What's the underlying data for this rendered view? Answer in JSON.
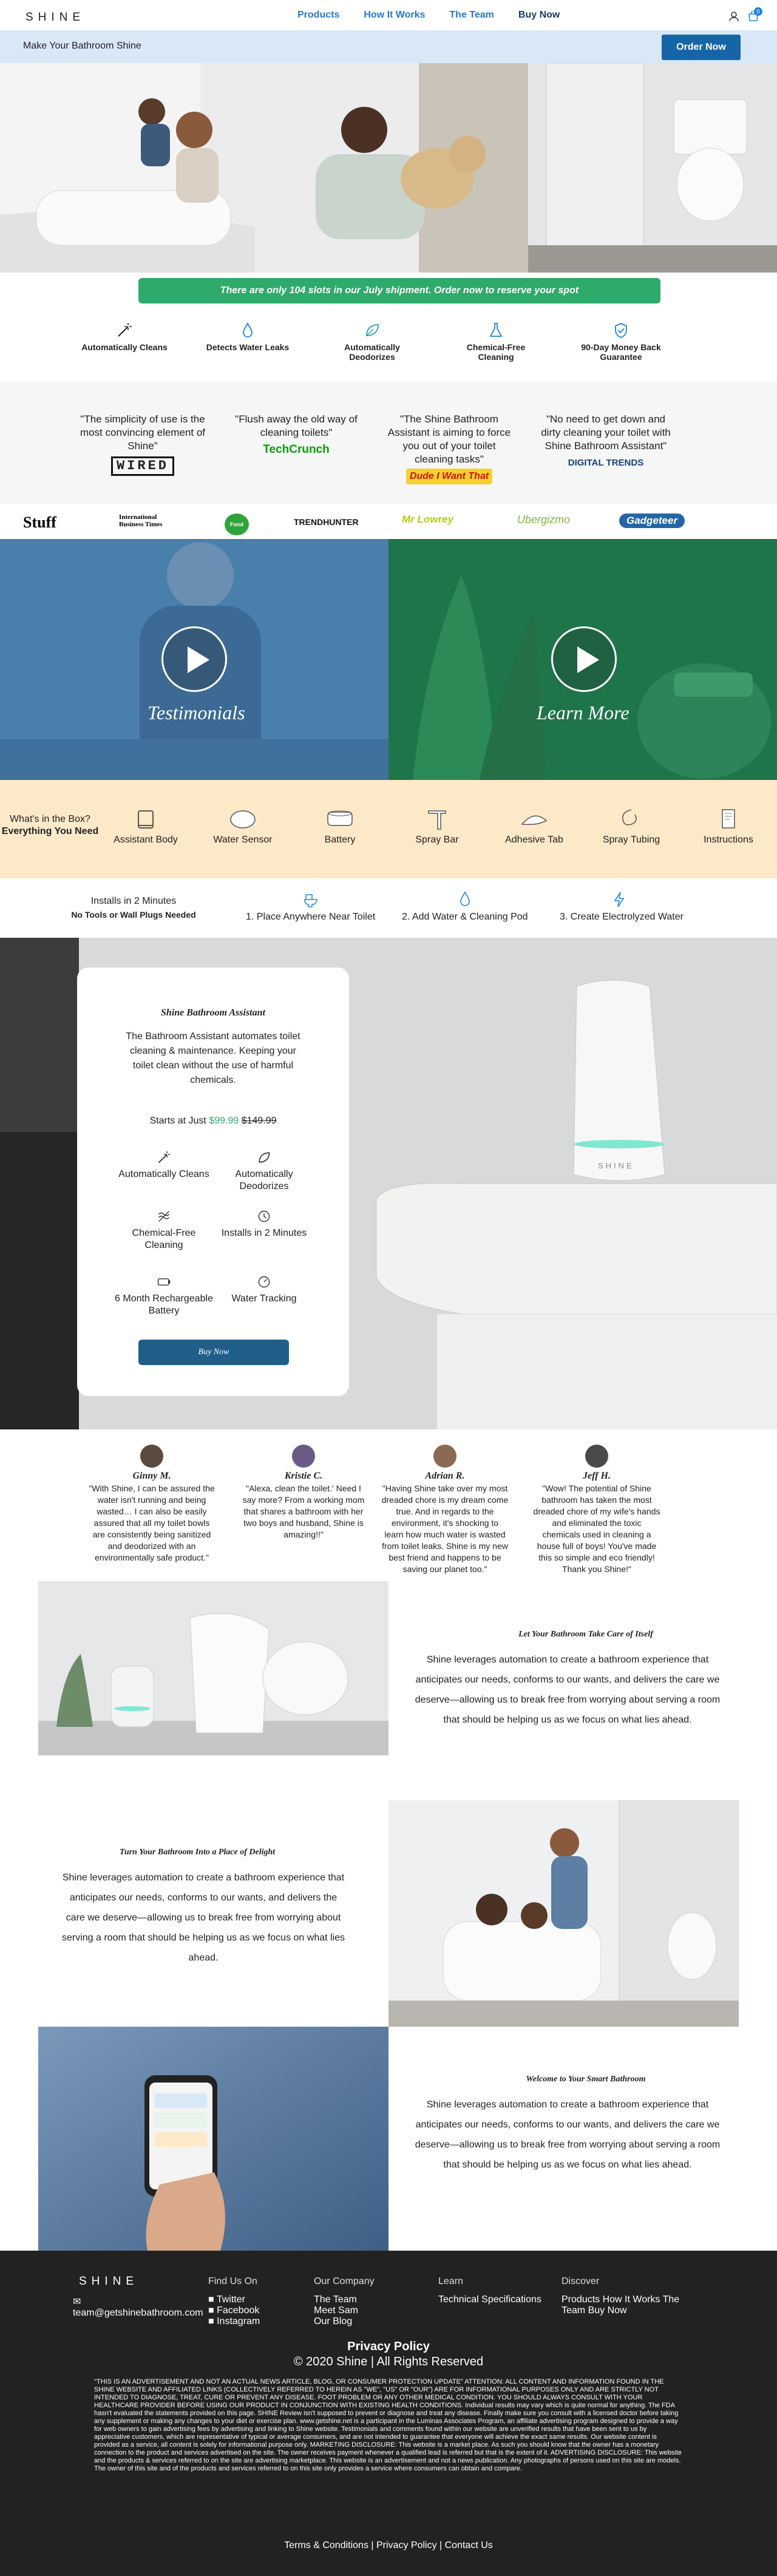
{
  "header": {
    "logo": "SHINE",
    "nav": [
      "Products",
      "How It Works",
      "The Team",
      "Buy Now"
    ],
    "cart_count": "0"
  },
  "subbar": {
    "title": "Make Your Bathroom Shine",
    "order_button": "Order Now"
  },
  "promo": "There are only 104 slots in our July shipment. Order now to reserve your spot",
  "features": [
    {
      "icon": "wand-icon",
      "label": "Automatically Cleans"
    },
    {
      "icon": "droplet-icon",
      "label": "Detects Water Leaks"
    },
    {
      "icon": "leaf-icon",
      "label": "Automatically Deodorizes"
    },
    {
      "icon": "flask-icon",
      "label": "Chemical-Free Cleaning"
    },
    {
      "icon": "shield-check-icon",
      "label": "90-Day Money Back Guarantee"
    }
  ],
  "quotes": [
    {
      "text": "\"The simplicity of use is the most convincing element of Shine\"",
      "source": "WIRED"
    },
    {
      "text": "\"Flush away the old way of cleaning toilets\"",
      "source": "TechCrunch"
    },
    {
      "text": "\"The Shine Bathroom Assistant is aiming to force you out of your toilet cleaning tasks\"",
      "source": "Dude I Want That"
    },
    {
      "text": "\"No need to get down and dirty cleaning your toilet with Shine Bathroom Assistant\"",
      "source": "DIGITAL TRENDS"
    }
  ],
  "press_logos": [
    "Stuff",
    "International Business Times",
    "Food Network",
    "TRENDHUNTER",
    "Mr Lowrey",
    "Ubergizmo",
    "Gadgeteer"
  ],
  "videos": {
    "left_label": "Testimonials",
    "right_label": "Learn More"
  },
  "box": {
    "heading_line1": "What's in the Box?",
    "heading_line2": "Everything You Need",
    "items": [
      "Assistant Body",
      "Water Sensor",
      "Battery",
      "Spray Bar",
      "Adhesive Tab",
      "Spray Tubing",
      "Instructions"
    ]
  },
  "install": {
    "heading_line1": "Installs in 2 Minutes",
    "heading_line2": "No Tools or Wall Plugs Needed",
    "steps": [
      "1. Place Anywhere Near Toilet",
      "2. Add Water & Cleaning Pod",
      "3. Create Electrolyzed Water"
    ]
  },
  "product": {
    "title": "Shine Bathroom Assistant",
    "description": "The Bathroom Assistant automates toilet cleaning & maintenance. Keeping your toilet clean without the use of harmful chemicals.",
    "price_prefix": "Starts at Just",
    "price_sale": "$99.99",
    "price_orig": "$149.99",
    "features": [
      {
        "icon": "wand-icon",
        "label": "Automatically Cleans"
      },
      {
        "icon": "leaf-icon",
        "label": "Automatically Deodorizes"
      },
      {
        "icon": "chemical-free-icon",
        "label": "Chemical-Free Cleaning"
      },
      {
        "icon": "clock-icon",
        "label": "Installs in 2 Minutes"
      },
      {
        "icon": "battery-icon",
        "label": "6 Month Rechargeable Battery"
      },
      {
        "icon": "gauge-icon",
        "label": "Water Tracking"
      }
    ],
    "button": "Buy Now",
    "device_label": "SHINE"
  },
  "testimonials": [
    {
      "name": "Ginny M.",
      "text": "\"With Shine, I can be assured the water isn't running and being wasted… I can also be easily assured that all my toilet bowls are consistently being sanitized and deodorized with an environmentally safe product.\""
    },
    {
      "name": "Kristie C.",
      "text": "\"Alexa, clean the toilet.' Need I say more? From a working mom that shares a bathroom with her two boys and husband, Shine is amazing!!\""
    },
    {
      "name": "Adrian R.",
      "text": "\"Having Shine take over my most dreaded chore is my dream come true. And in regards to the environment, it's shocking to learn how much water is wasted from toilet leaks. Shine is my new best friend and happens to be saving our planet too.\""
    },
    {
      "name": "Jeff H.",
      "text": "\"Wow! The potential of Shine bathroom has taken the most dreaded chore of my wife's hands and eliminated the toxic chemicals used in cleaning a house full of boys! You've made this so simple and eco friendly! Thank you Shine!\""
    }
  ],
  "stories": [
    {
      "title": "Let Your Bathroom Take Care of Itself",
      "body": "Shine leverages automation to create a bathroom experience that anticipates our needs, conforms to our wants, and delivers the care we deserve—allowing us to break free from worrying about serving a room that should be helping us as we focus on what lies ahead."
    },
    {
      "title": "Turn Your Bathroom Into a Place of Delight",
      "body": "Shine leverages automation to create a bathroom experience that anticipates our needs, conforms to our wants, and delivers the care we deserve—allowing us to break free from worrying about serving a room that should be helping us as we focus on what lies ahead."
    },
    {
      "title": "Welcome to Your Smart Bathroom",
      "body": "Shine leverages automation to create a bathroom experience that anticipates our needs, conforms to our wants, and delivers the care we deserve—allowing us to break free from worrying about serving a room that should be helping us as we focus on what lies ahead."
    }
  ],
  "footer": {
    "logo": "SHINE",
    "email": "team@getshinebathroom.com",
    "find_us": {
      "heading": "Find Us On",
      "links": [
        "Twitter",
        "Facebook",
        "Instagram"
      ]
    },
    "company": {
      "heading": "Our Company",
      "links": [
        "The Team",
        "Meet Sam",
        "Our Blog"
      ]
    },
    "learn": {
      "heading": "Learn",
      "links": [
        "Technical Specifications"
      ]
    },
    "discover": {
      "heading": "Discover",
      "links_text": "Products How It Works The Team Buy Now"
    },
    "privacy": "Privacy Policy",
    "copyright": "© 2020 Shine | All Rights Reserved",
    "disclaimer": "\"THIS IS AN ADVERTISEMENT AND NOT AN ACTUAL NEWS ARTICLE, BLOG, OR CONSUMER PROTECTION UPDATE\" ATTENTION: ALL CONTENT AND INFORMATION FOUND IN THE SHINE WEBSITE AND AFFILIATED LINKS (COLLECTIVELY REFERRED TO HEREIN AS \"WE\", \"US\" OR \"OUR\") ARE FOR INFORMATIONAL PURPOSES ONLY AND ARE STRICTLY NOT INTENDED TO DIAGNOSE, TREAT, CURE OR PREVENT ANY DISEASE. FOOT PROBLEM OR ANY OTHER MEDICAL CONDITION. YOU SHOULD ALWAYS CONSULT WITH YOUR HEALTHCARE PROVIDER BEFORE USING OUR PRODUCT IN CONJUNCTION WITH EXISTING HEALTH CONDITIONS. Individual results may vary which is quite normal for anything. The FDA hasn't evaluated the statements provided on this page. SHINE Review isn't supposed to prevent or diagnose and treat any disease. Finally make sure you consult with a licensed doctor before taking any supplement or making any changes to your diet or exercise plan. www.getshine.net is a participant in the Luminas Associates Program, an affiliate advertising program designed to provide a way for web owners to gain advertising fees by advertising and linking to Shine website. Testimonials and comments found within our website are unverified results that have been sent to us by appreciative customers, which are representative of typical or average consumers, and are not intended to guarantee that everyone will achieve the exact same results. Our website content is provided as a service, all content is solely for informational purpose only. MARKETING DISCLOSURE: This website is a market place. As such you should know that the owner has a monetary connection to the product and services advertised on the site. The owner receives payment whenever a qualified lead is referred but that is the extent of it. ADVERTISING DISCLOSURE: This website and the products & services referred to on the site are advertising marketplace. This website is an advertisement and not a news publication. Any photographs of persons used on this site are models. The owner of this site and of the products and services referred to on this site only provides a service where consumers can obtain and compare.",
    "bottom_links": [
      "Terms & Conditions",
      "Privacy Policy",
      "Contact Us"
    ]
  },
  "colors": {
    "accent_blue": "#1565a8",
    "nav_blue": "#2a78c9",
    "promo_green": "#2eaa6b",
    "box_peach": "#fde9c8",
    "video_blue": "#4c7fad",
    "video_green": "#1f7a4d",
    "footer_dark": "#222222"
  }
}
